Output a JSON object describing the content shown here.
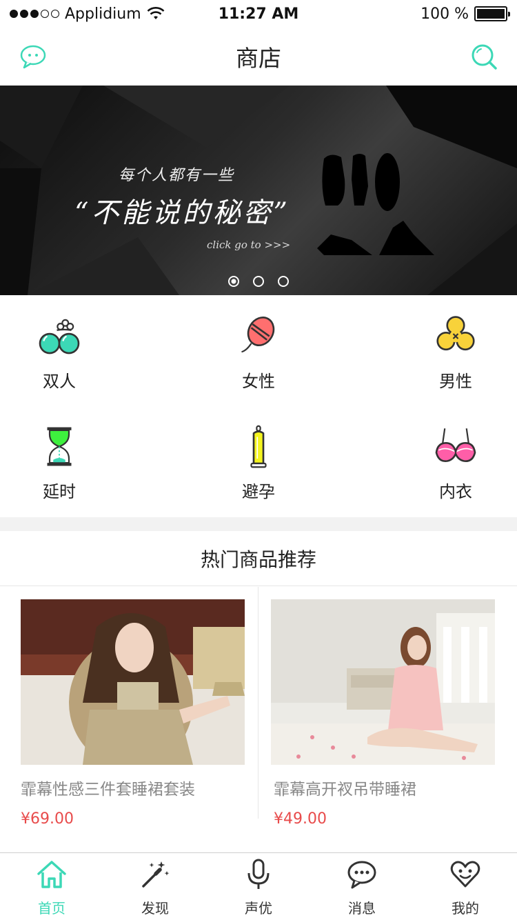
{
  "status_bar": {
    "carrier": "Applidium",
    "time": "11:27 AM",
    "battery": "100 %"
  },
  "header": {
    "title": "商店",
    "left_icon": "chat-bubble-icon",
    "right_icon": "search-icon"
  },
  "banner": {
    "line1": "每个人都有一些",
    "line2": "“不能说的秘密”",
    "line3": "click go to >>>",
    "page_count": 3,
    "active_page": 1
  },
  "categories": [
    {
      "label": "双人",
      "icon": "balls-icon"
    },
    {
      "label": "女性",
      "icon": "egg-vibrator-icon"
    },
    {
      "label": "男性",
      "icon": "trefoil-icon"
    },
    {
      "label": "延时",
      "icon": "hourglass-icon"
    },
    {
      "label": "避孕",
      "icon": "condom-icon"
    },
    {
      "label": "内衣",
      "icon": "bra-icon"
    }
  ],
  "hot_section": {
    "title": "热门商品推荐"
  },
  "products": [
    {
      "name": "霏幕性感三件套睡裙套装",
      "price": "¥69.00"
    },
    {
      "name": "霏幕高开衩吊带睡裙",
      "price": "¥49.00"
    }
  ],
  "tabbar": [
    {
      "label": "首页",
      "icon": "home-icon",
      "active": true
    },
    {
      "label": "发现",
      "icon": "magic-wand-icon",
      "active": false
    },
    {
      "label": "声优",
      "icon": "microphone-icon",
      "active": false
    },
    {
      "label": "消息",
      "icon": "message-icon",
      "active": false
    },
    {
      "label": "我的",
      "icon": "heart-face-icon",
      "active": false
    }
  ],
  "colors": {
    "accent": "#3cd8b6",
    "price": "#e84b4b"
  }
}
